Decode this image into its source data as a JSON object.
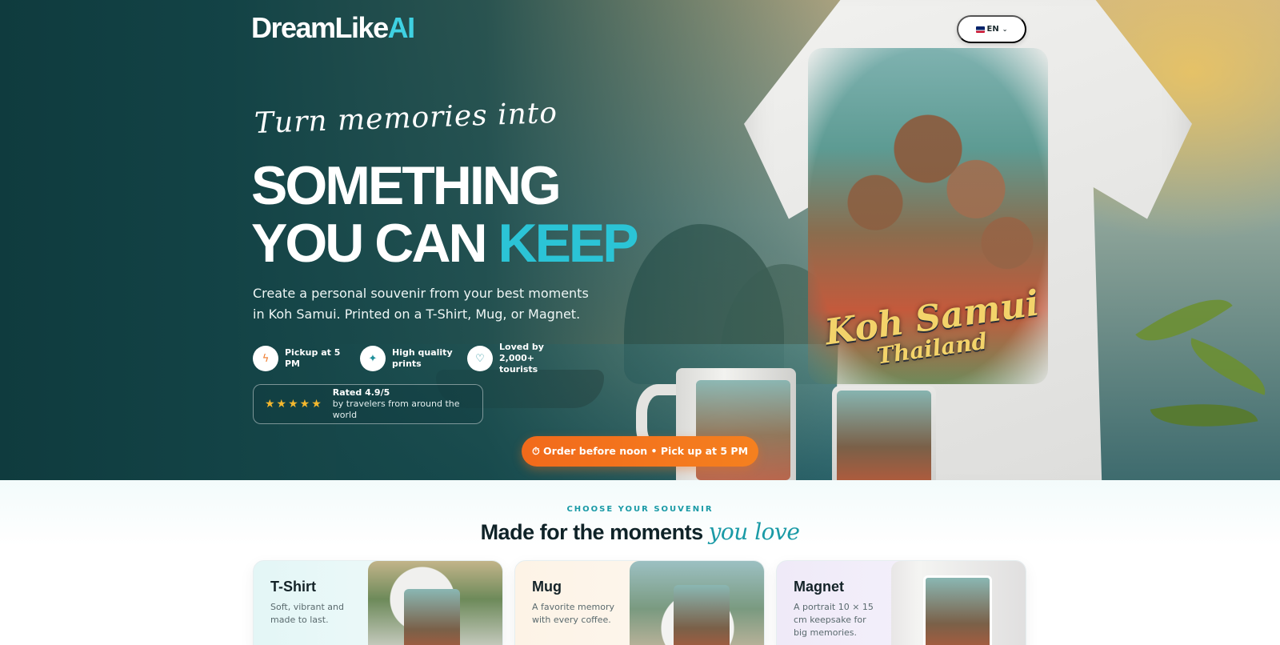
{
  "brand": {
    "name_main": "DreamLike",
    "name_accent": "AI"
  },
  "language": {
    "label": "EN",
    "flag_icon": "uk-flag-icon",
    "chevron": "chevron-down-icon"
  },
  "hero": {
    "tagline": "Turn memories into",
    "headline_line1": "SOMETHING",
    "headline_line2_main": "YOU CAN ",
    "headline_line2_accent": "KEEP",
    "subtitle": "Create a personal souvenir from your best moments in Koh Samui. Printed on a T-Shirt, Mug, or Magnet.",
    "features": [
      {
        "icon": "lightning-icon",
        "text": "Pickup at 5 PM"
      },
      {
        "icon": "sparkle-icon",
        "text": "High quality prints"
      },
      {
        "icon": "heart-icon",
        "text": "Loved by 2,000+ tourists"
      }
    ],
    "rating": {
      "stars": "★★★★★",
      "star_count": 5,
      "title": "Rated 4.9/5",
      "subtitle": "by travelers from around the world"
    },
    "cta": "⏱ Order before noon • Pick up at 5 PM",
    "print_title_line1": "Koh Samui",
    "print_title_line2": "Thailand"
  },
  "souvenir_section": {
    "eyebrow": "CHOOSE YOUR SOUVENIR",
    "title_main": "Made for the moments ",
    "title_script": "you love",
    "cards": [
      {
        "title": "T-Shirt",
        "description": "Soft, vibrant and made to last."
      },
      {
        "title": "Mug",
        "description": "A favorite memory with every coffee."
      },
      {
        "title": "Magnet",
        "description": "A portrait 10 × 15 cm keepsake for big memories."
      }
    ]
  },
  "colors": {
    "accent": "#2bc4d6",
    "cta": "#f26a1b",
    "stars": "#f5b82e",
    "hero_dark": "#0f3b3e"
  }
}
